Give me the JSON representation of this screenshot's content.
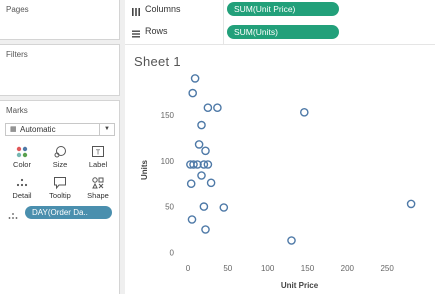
{
  "sidebar": {
    "pages": {
      "title": "Pages"
    },
    "filters": {
      "title": "Filters"
    },
    "marks": {
      "title": "Marks",
      "mark_type": "Automatic",
      "buttons": [
        {
          "label": "Color",
          "icon": "color-dots-icon"
        },
        {
          "label": "Size",
          "icon": "size-icon"
        },
        {
          "label": "Label",
          "icon": "label-icon"
        },
        {
          "label": "Detail",
          "icon": "detail-icon"
        },
        {
          "label": "Tooltip",
          "icon": "tooltip-icon"
        },
        {
          "label": "Shape",
          "icon": "shape-icon"
        }
      ],
      "detail_pill": "DAY(Order Da.."
    }
  },
  "shelves": {
    "columns": {
      "label": "Columns",
      "pill": "SUM(Unit Price)"
    },
    "rows": {
      "label": "Rows",
      "pill": "SUM(Units)"
    }
  },
  "sheet": {
    "title": "Sheet 1"
  },
  "colors": {
    "shelf_pill": "#22a07a",
    "detail_pill": "#4a8fae",
    "point_stroke": "#4e79a7"
  },
  "chart_data": {
    "type": "scatter",
    "title": "",
    "xlabel": "Unit Price",
    "ylabel": "Units",
    "xlim": [
      -10,
      300
    ],
    "ylim": [
      -5,
      185
    ],
    "xticks": [
      0,
      50,
      100,
      150,
      200,
      250
    ],
    "yticks": [
      0,
      50,
      100,
      150
    ],
    "grid": false,
    "points": [
      {
        "x": 9,
        "y": 190
      },
      {
        "x": 6,
        "y": 174
      },
      {
        "x": 25,
        "y": 158
      },
      {
        "x": 37,
        "y": 158
      },
      {
        "x": 146,
        "y": 153
      },
      {
        "x": 17,
        "y": 139
      },
      {
        "x": 14,
        "y": 118
      },
      {
        "x": 22,
        "y": 111
      },
      {
        "x": 3,
        "y": 96
      },
      {
        "x": 7,
        "y": 96
      },
      {
        "x": 12,
        "y": 96
      },
      {
        "x": 20,
        "y": 96
      },
      {
        "x": 25,
        "y": 96
      },
      {
        "x": 17,
        "y": 84
      },
      {
        "x": 4,
        "y": 75
      },
      {
        "x": 29,
        "y": 76
      },
      {
        "x": 20,
        "y": 50
      },
      {
        "x": 45,
        "y": 49
      },
      {
        "x": 280,
        "y": 53
      },
      {
        "x": 5,
        "y": 36
      },
      {
        "x": 22,
        "y": 25
      },
      {
        "x": 130,
        "y": 13
      }
    ]
  }
}
